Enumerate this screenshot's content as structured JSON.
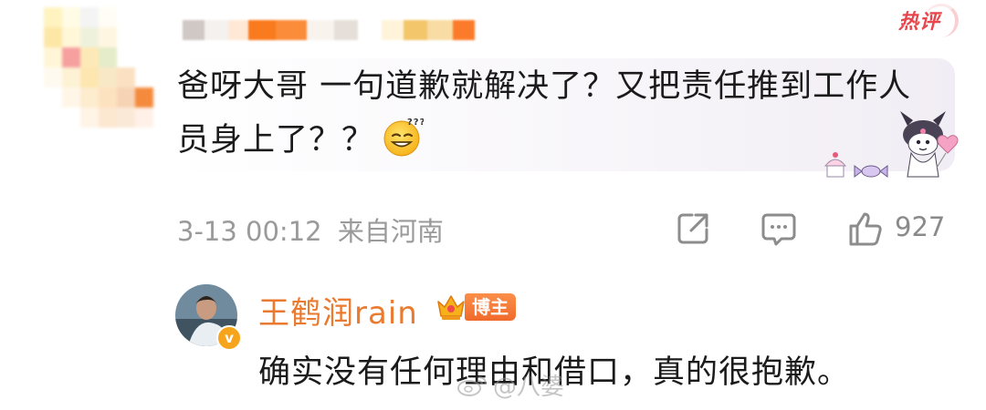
{
  "comment": {
    "hot_label": "热评",
    "text": "爸呀大哥 一句道歉就解决了？又把责任推到工作人员身上了？？",
    "time": "3-13 00:12",
    "location": "来自河南",
    "like_count": "927"
  },
  "reply": {
    "author": "王鹤润rain",
    "role_badge": "博主",
    "text": "确实没有任何理由和借口，真的很抱歉。"
  },
  "watermark": {
    "text": "@八婆"
  },
  "colors": {
    "hot": "#e8464d",
    "author_name": "#ea7a2f",
    "meta": "#9a9a9a",
    "text": "#1b1b1b"
  },
  "icons": [
    "share-icon",
    "comment-icon",
    "like-icon",
    "emoji-sweat-icon",
    "crown-icon",
    "weibo-logo-icon"
  ]
}
